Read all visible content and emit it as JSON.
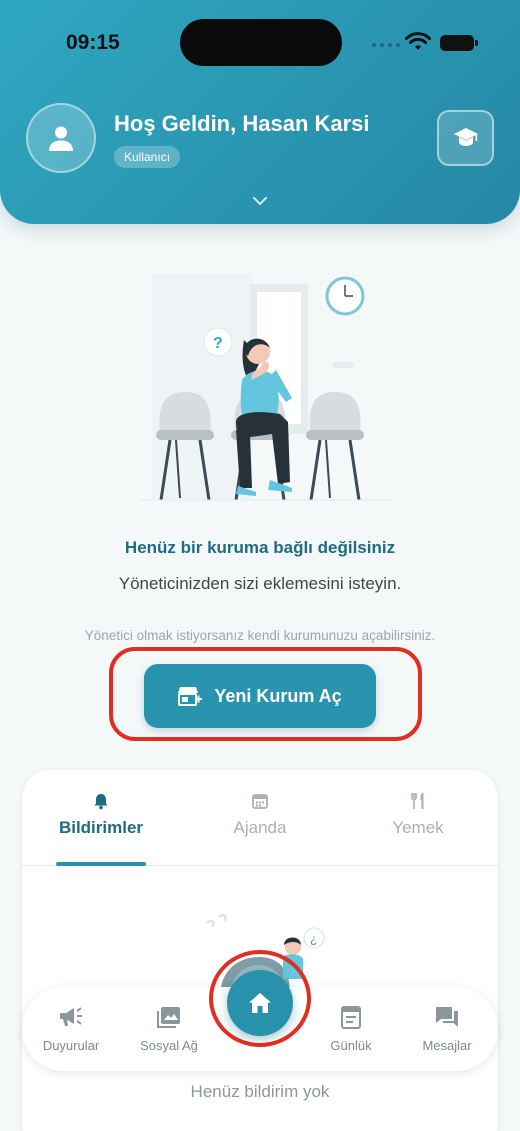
{
  "status_bar": {
    "time": "09:15"
  },
  "header": {
    "greeting": "Hoş Geldin, Hasan Karsi",
    "role": "Kullanıcı",
    "avatar_icon": "user-icon",
    "action_icon": "graduation-cap-icon",
    "expand_icon": "chevron-down-icon"
  },
  "empty_state": {
    "title": "Henüz bir kuruma bağlı değilsiniz",
    "subtitle": "Yöneticinizden sizi eklemesini isteyin.",
    "admin_hint": "Yönetici olmak istiyorsanız kendi kurumunuzu açabilirsiniz.",
    "create_button": {
      "label": "Yeni Kurum Aç",
      "icon": "store-add-icon"
    }
  },
  "tabs": [
    {
      "label": "Bildirimler",
      "icon": "bell-icon",
      "active": true
    },
    {
      "label": "Ajanda",
      "icon": "calendar-icon",
      "active": false
    },
    {
      "label": "Yemek",
      "icon": "fork-knife-icon",
      "active": false
    }
  ],
  "notifications": {
    "empty_text": "Henüz bildirim yok"
  },
  "bottom_nav": {
    "items": [
      {
        "label": "Duyurular",
        "icon": "megaphone-icon"
      },
      {
        "label": "Sosyal Ağ",
        "icon": "image-icon"
      },
      {
        "label": "",
        "icon": "home-icon"
      },
      {
        "label": "Günlük",
        "icon": "journal-icon"
      },
      {
        "label": "Mesajlar",
        "icon": "chat-icon"
      }
    ]
  },
  "colors": {
    "primary": "#2a93ad",
    "primary_dark": "#1d6b84",
    "highlight": "#e02e21"
  }
}
